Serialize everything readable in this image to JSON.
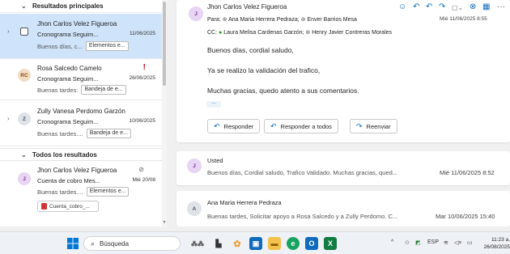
{
  "sidebar": {
    "section_top": "Resultados principales",
    "section_all": "Todos los resultados",
    "mails": [
      {
        "initials": "J",
        "from": "Jhon Carlos Velez Figueroa",
        "subject": "Cronograma Seguim...",
        "date": "11/06/2025",
        "preview": "Buenos días, c...",
        "tag": "Elementos e..."
      },
      {
        "initials": "RC",
        "from": "Rosa Salcedo Camelo",
        "subject": "Cronograma Seguim...",
        "date": "26/06/2025",
        "preview": "Buenas tardes:",
        "tag": "Bandeja de e...",
        "flag": "!"
      },
      {
        "initials": "Z",
        "from": "Zully Vanesa Perdomo Garzón",
        "subject": "Cronograma Seguim...",
        "date": "10/06/2025",
        "preview": "Buenas tardes....",
        "tag": "Bandeja de e..."
      },
      {
        "initials": "J",
        "from": "Jhon Carlos Velez Figueroa",
        "subject": "Cuenta de cobro Mes...",
        "date": "Mié 20/08",
        "preview": "Buenas tardes....",
        "tag": "Elementos e...",
        "attachment": "Cuenta_cobro_..."
      }
    ]
  },
  "reading": {
    "message": {
      "initials": "J",
      "from": "Jhon Carlos Velez Figueroa",
      "to_label": "Para:",
      "to": [
        "Ana Maria Herrera Pedraza;",
        "Enver Barrios Mesa"
      ],
      "cc_label": "CC:",
      "cc": [
        "Laura Melisa Cardenas Garzón;",
        "Henry Javier Contreras Morales"
      ],
      "date": "Mié 11/06/2025 8:55",
      "body": [
        "Buenos días, cordial saludo,",
        "Ya se realizo la validación del trafico,",
        "Muchas gracias, quedo atento a sus comentarios."
      ],
      "ellipsis": "...",
      "reply": "Responder",
      "reply_all": "Responder a todos",
      "forward": "Reenviar"
    },
    "thread": [
      {
        "initials": "J",
        "from": "Usted",
        "preview": "Buenos días, Cordial saludo, Trafico Validado. Muchas gracias, qued...",
        "date": "Mié 11/06/2025 8:52"
      },
      {
        "initials": "A",
        "from": "Ana Maria Herrera Pedraza",
        "preview": "Buenas tardes, Solicitar apoyo a Rosa Salcedo y a Zully Perdomo. C...",
        "date": "Mar 10/06/2025 15:40"
      }
    ]
  },
  "taskbar": {
    "search_label": "Búsqueda",
    "lang": "ESP",
    "time": "11:23 a.",
    "date": "26/08/2025"
  },
  "colors": {
    "accent": "#0f6cbd",
    "selected_row": "#cfe4fa",
    "avatar_j": "#e8d4f3",
    "avatar_rc": "#f3dcc4",
    "avatar_z": "#dfe3e8",
    "avatar_a": "#dfe3e8"
  }
}
